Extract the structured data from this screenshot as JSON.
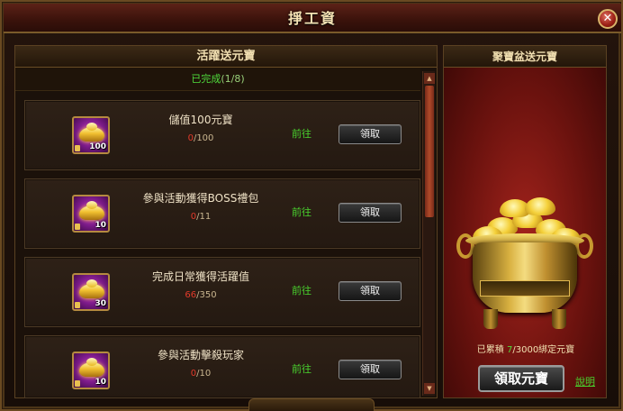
{
  "window": {
    "title": "掙工資",
    "close_glyph": "✕"
  },
  "left": {
    "header": "活躍送元寶",
    "progress_label": "已完成",
    "progress_count": "(1/8)",
    "tasks": [
      {
        "name": "儲值100元寶",
        "current": "0",
        "total": "/100",
        "qty": "100",
        "goto": "前往",
        "claim": "領取"
      },
      {
        "name": "參與活動獲得BOSS禮包",
        "current": "0",
        "total": "/11",
        "qty": "10",
        "goto": "前往",
        "claim": "領取"
      },
      {
        "name": "完成日常獲得活躍值",
        "current": "66",
        "total": "/350",
        "qty": "30",
        "goto": "前往",
        "claim": "領取"
      },
      {
        "name": "參與活動擊殺玩家",
        "current": "0",
        "total": "/10",
        "qty": "10",
        "goto": "前往",
        "claim": "領取"
      }
    ]
  },
  "right": {
    "header": "聚寶盆送元寶",
    "accum_prefix": "已累積",
    "accum_current": "7",
    "accum_suffix": "/3000綁定元寶",
    "claim_button": "領取元寶",
    "explain_link": "說明"
  },
  "colors": {
    "accent_green": "#49d22e",
    "progress_red": "#e23a2a",
    "title_gold": "#f6e3b4"
  },
  "icons": {
    "task_icon": "gold-ingot-icon",
    "close": "close-icon"
  }
}
